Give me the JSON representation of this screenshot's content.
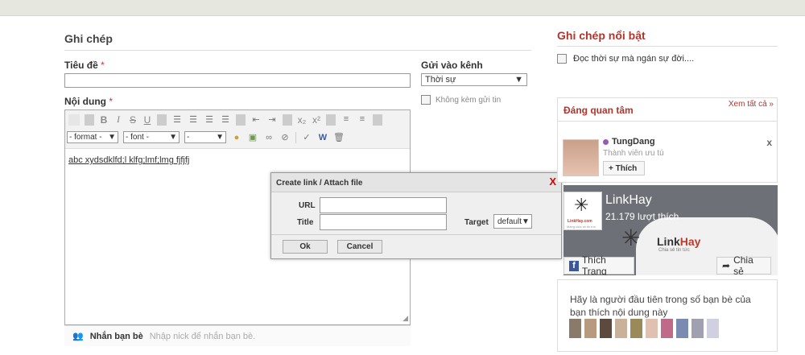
{
  "left": {
    "title": "Ghi chép",
    "title_label": "Tiêu đề",
    "required_mark": "*",
    "content_label": "Nội dung",
    "channel_label": "Gửi vào kênh",
    "channel_value": "Thời sự",
    "no_notify_label": "Không kèm gửi tin",
    "toolbar": {
      "bold": "B",
      "italic": "I",
      "strike": "S",
      "underline": "U",
      "sub": "x₂",
      "sup": "x²",
      "format_select": "- format -",
      "font_select": "- font -",
      "size_select": "-"
    },
    "editor_text": "abc xydsdklfd;l klfg;lmf;lmg  fjfjfj",
    "tag_friends_label": "Nhắn bạn bè",
    "tag_friends_placeholder": "Nhập nick để nhắn bạn bè."
  },
  "dialog": {
    "title": "Create link / Attach file",
    "close": "X",
    "url_label": "URL",
    "title_label": "Title",
    "target_label": "Target",
    "target_value": "default",
    "ok": "Ok",
    "cancel": "Cancel"
  },
  "right": {
    "featured_title": "Ghi chép nổi bật",
    "featured_item": "Đọc thời sự mà ngán sự đời....",
    "interest_title": "Đáng quan tâm",
    "see_all": "Xem tất cả »",
    "user_name": "TungDang",
    "user_role": "Thành viên ưu tú",
    "like_button": "+ Thích",
    "dismiss": "x",
    "fb_page_name": "LinkHay",
    "fb_likes": "21.179 lượt thích",
    "fb_logo_text": "LinkHay.com",
    "fb_logo_sub": "Mạng chia sẻ tin tức",
    "fb_brand_a": "Link",
    "fb_brand_b": "Hay",
    "fb_brand_sub": "Chia sẻ tin tức",
    "fb_like_page": "Thích Trang",
    "fb_share": "Chia sẻ",
    "friends_text": "Hãy là người đầu tiên trong số bạn bè của bạn thích nội dung này"
  },
  "colors": {
    "accent_red": "#b2342c",
    "fb_blue": "#3b5998",
    "linkhay_red": "#c0392b"
  }
}
